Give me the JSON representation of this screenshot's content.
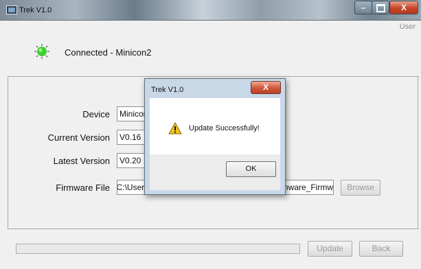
{
  "window": {
    "title": "Trek V1.0",
    "min_glyph": "–",
    "close_glyph": "X",
    "user_link": "User"
  },
  "status": {
    "text": "Connected - Minicon2",
    "led_color": "#3fd12f"
  },
  "form": {
    "device_label": "Device",
    "device_value": "Minicon2",
    "current_version_label": "Current Version",
    "current_version_value": "V0.16",
    "latest_version_label": "Latest Version",
    "latest_version_value": "V0.20",
    "firmware_file_label": "Firmware File",
    "firmware_file_value": "C:\\Users\\Administrator\\Desktop\\Minicon2_Firmware_Firmw"
  },
  "buttons": {
    "browse": "Browse",
    "update": "Update",
    "back": "Back"
  },
  "progress": {
    "value": 0
  },
  "dialog": {
    "title": "Trek V1.0",
    "close_glyph": "X",
    "icon": "warning-icon",
    "message": "Update Successfully!",
    "ok_label": "OK"
  }
}
